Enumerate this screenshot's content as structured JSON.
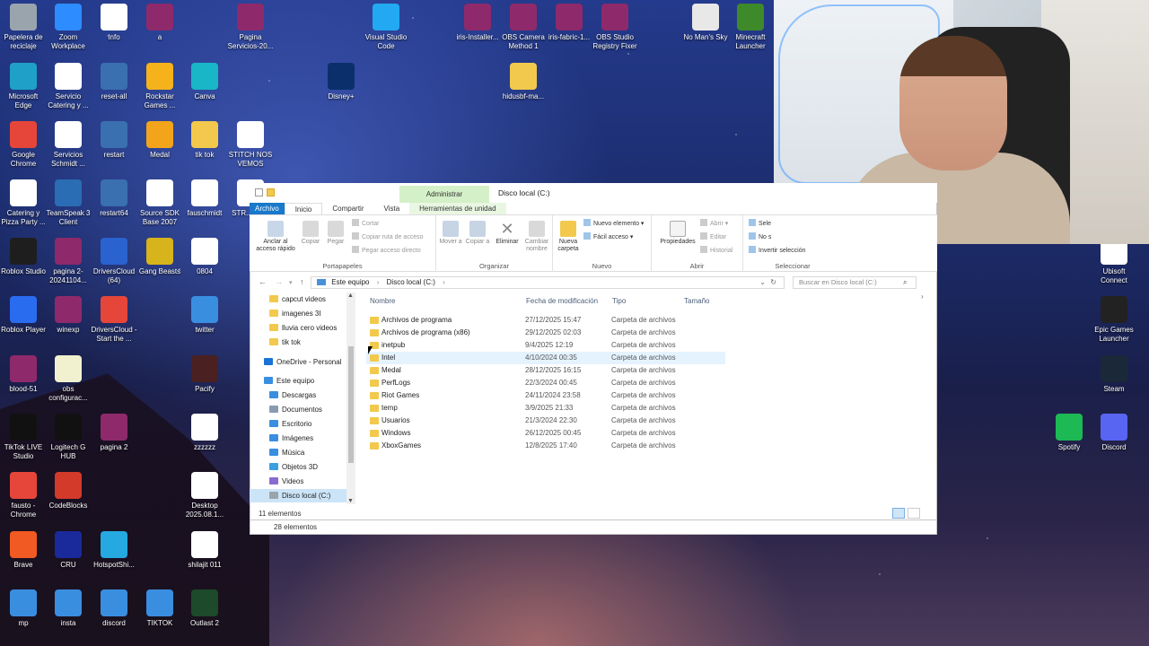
{
  "desktop": {
    "icons": [
      {
        "label": "Papelera de reciclaje",
        "icon": "recycle-bin-icon",
        "color": "#9aa4ad"
      },
      {
        "label": "Zoom Workplace",
        "icon": "zoom-icon",
        "color": "#2d8cff"
      },
      {
        "label": "Info",
        "icon": "text-file-icon",
        "color": "#ffffff"
      },
      {
        "label": "a",
        "icon": "winrar-icon",
        "color": "#8e2a6b"
      },
      {
        "label": "Pagina Servicios-20...",
        "icon": "winrar-icon",
        "color": "#8e2a6b"
      },
      {
        "label": "Visual Studio Code",
        "icon": "vscode-icon",
        "color": "#23a9f2"
      },
      {
        "label": "iris-Installer...",
        "icon": "winrar-icon",
        "color": "#8e2a6b"
      },
      {
        "label": "OBS Camera Method 1",
        "icon": "winrar-icon",
        "color": "#8e2a6b"
      },
      {
        "label": "iris-fabric-1...",
        "icon": "winrar-icon",
        "color": "#8e2a6b"
      },
      {
        "label": "OBS Studio Registry Fixer",
        "icon": "winrar-icon",
        "color": "#8e2a6b"
      },
      {
        "label": "No Man's Sky",
        "icon": "no-mans-sky-icon",
        "color": "#e8e8e8"
      },
      {
        "label": "Minecraft Launcher",
        "icon": "minecraft-icon",
        "color": "#3e8a2b"
      },
      {
        "label": "Microsoft Edge",
        "icon": "edge-icon",
        "color": "#1fa0c9"
      },
      {
        "label": "Servicio Catering y ...",
        "icon": "video-file-icon",
        "color": "#ffffff"
      },
      {
        "label": "reset-all",
        "icon": "batch-file-icon",
        "color": "#3a6fb0"
      },
      {
        "label": "Rockstar Games ...",
        "icon": "rockstar-icon",
        "color": "#f6b21b"
      },
      {
        "label": "Canva",
        "icon": "canva-icon",
        "color": "#19b6c8"
      },
      {
        "label": "Disney+",
        "icon": "disney-plus-icon",
        "color": "#0b2f6b"
      },
      {
        "label": "hidusbf-ma...",
        "icon": "folder-icon",
        "color": "#f2c94c"
      },
      {
        "label": "Google Chrome",
        "icon": "chrome-icon",
        "color": "#e6463a"
      },
      {
        "label": "Servicios Schmidt ...",
        "icon": "video-file-icon",
        "color": "#ffffff"
      },
      {
        "label": "restart",
        "icon": "batch-file-icon",
        "color": "#3a6fb0"
      },
      {
        "label": "Medal",
        "icon": "medal-icon",
        "color": "#f2a51b"
      },
      {
        "label": "tik tok",
        "icon": "folder-icon",
        "color": "#f2c94c"
      },
      {
        "label": "STITCH NOS VEMOS",
        "icon": "video-file-icon",
        "color": "#ffffff"
      },
      {
        "label": "Catering y Pizza Party ...",
        "icon": "video-file-icon",
        "color": "#ffffff"
      },
      {
        "label": "TeamSpeak 3 Client",
        "icon": "teamspeak-icon",
        "color": "#2a6db4"
      },
      {
        "label": "restart64",
        "icon": "batch-file-icon",
        "color": "#3a6fb0"
      },
      {
        "label": "Source SDK Base 2007",
        "icon": "file-icon",
        "color": "#ffffff"
      },
      {
        "label": "fauschmidt",
        "icon": "video-file-icon",
        "color": "#ffffff"
      },
      {
        "label": "STR... INI...",
        "icon": "video-file-icon",
        "color": "#ffffff"
      },
      {
        "label": "Roblox Studio",
        "icon": "roblox-studio-icon",
        "color": "#1e1e1e"
      },
      {
        "label": "pagina 2-20241104...",
        "icon": "winrar-icon",
        "color": "#8e2a6b"
      },
      {
        "label": "DriversCloud (64)",
        "icon": "driverscloud-icon",
        "color": "#2a62d0"
      },
      {
        "label": "Gang Beasts",
        "icon": "gang-beasts-icon",
        "color": "#d7b31c"
      },
      {
        "label": "0804",
        "icon": "video-file-icon",
        "color": "#ffffff"
      },
      {
        "label": "Roblox Player",
        "icon": "roblox-icon",
        "color": "#2a6cf0"
      },
      {
        "label": "winexp",
        "icon": "winrar-icon",
        "color": "#8e2a6b"
      },
      {
        "label": "DriversCloud - Start the ...",
        "icon": "chrome-icon",
        "color": "#e6463a"
      },
      {
        "label": "twitter",
        "icon": "image-file-icon",
        "color": "#3a8ee0"
      },
      {
        "label": "blood-51",
        "icon": "winrar-icon",
        "color": "#8e2a6b"
      },
      {
        "label": "obs configurac...",
        "icon": "json-file-icon",
        "color": "#f1f1d0"
      },
      {
        "label": "Pacify",
        "icon": "pacify-icon",
        "color": "#4a2020"
      },
      {
        "label": "TikTok LIVE Studio",
        "icon": "tiktok-icon",
        "color": "#111111"
      },
      {
        "label": "Logitech G HUB",
        "icon": "logitech-icon",
        "color": "#111111"
      },
      {
        "label": "pagina 2",
        "icon": "winrar-icon",
        "color": "#8e2a6b"
      },
      {
        "label": "zzzzzz",
        "icon": "video-file-icon",
        "color": "#ffffff"
      },
      {
        "label": "fausto - Chrome",
        "icon": "chrome-icon",
        "color": "#e6463a"
      },
      {
        "label": "CodeBlocks",
        "icon": "codeblocks-icon",
        "color": "#d33a2a"
      },
      {
        "label": "Desktop 2025.08.1...",
        "icon": "video-file-icon",
        "color": "#ffffff"
      },
      {
        "label": "Brave",
        "icon": "brave-icon",
        "color": "#f15a22"
      },
      {
        "label": "CRU",
        "icon": "cru-icon",
        "color": "#1a2a9a"
      },
      {
        "label": "HotspotShi...",
        "icon": "hotspot-shield-icon",
        "color": "#25a9e0"
      },
      {
        "label": "shilajit 011",
        "icon": "video-file-icon",
        "color": "#ffffff"
      },
      {
        "label": "mp",
        "icon": "image-file-icon",
        "color": "#3a8ee0"
      },
      {
        "label": "insta",
        "icon": "image-file-icon",
        "color": "#3a8ee0"
      },
      {
        "label": "discord",
        "icon": "image-file-icon",
        "color": "#3a8ee0"
      },
      {
        "label": "TIKTOK",
        "icon": "image-file-icon",
        "color": "#3a8ee0"
      },
      {
        "label": "Outlast 2",
        "icon": "outlast-icon",
        "color": "#1d4a2a"
      },
      {
        "label": "Ubisoft Connect",
        "icon": "ubisoft-icon",
        "color": "#ffffff"
      },
      {
        "label": "Epic Games Launcher",
        "icon": "epic-games-icon",
        "color": "#222222"
      },
      {
        "label": "Steam",
        "icon": "steam-icon",
        "color": "#1b2838"
      },
      {
        "label": "Spotify",
        "icon": "spotify-icon",
        "color": "#1db954"
      },
      {
        "label": "Discord",
        "icon": "discord-icon",
        "color": "#5865f2"
      }
    ]
  },
  "explorer": {
    "title": "Disco local (C:)",
    "context_tab": "Administrar",
    "tabs": [
      "Archivo",
      "Inicio",
      "Compartir",
      "Vista",
      "Herramientas de unidad"
    ],
    "ribbon": {
      "portapapeles": {
        "label": "Portapapeles",
        "pin": "Anclar al acceso rápido",
        "copy": "Copiar",
        "paste": "Pegar",
        "cut": "Cortar",
        "copy_path": "Copiar ruta de acceso",
        "paste_shortcut": "Pegar acceso directo"
      },
      "organizar": {
        "label": "Organizar",
        "move": "Mover a",
        "copy_to": "Copiar a",
        "delete": "Eliminar",
        "rename": "Cambiar nombre"
      },
      "nuevo": {
        "label": "Nuevo",
        "new_folder": "Nueva carpeta",
        "new_item": "Nuevo elemento",
        "easy_access": "Fácil acceso"
      },
      "abrir": {
        "label": "Abrir",
        "properties": "Propiedades",
        "open": "Abrir",
        "edit": "Editar",
        "history": "Historial"
      },
      "seleccionar": {
        "label": "Seleccionar",
        "select_all": "Sele",
        "select_none": "No s",
        "invert": "Invertir selección"
      }
    },
    "address": {
      "segments": [
        "Este equipo",
        "Disco local (C:)"
      ],
      "search_placeholder": "Buscar en Disco local (C:)"
    },
    "nav_pane": [
      {
        "label": "capcut videos",
        "icon": "folder-icon",
        "color": "#f2c94c",
        "selected": false
      },
      {
        "label": "imagenes 3I",
        "icon": "folder-icon",
        "color": "#f2c94c",
        "selected": false
      },
      {
        "label": "lluvia cero videos",
        "icon": "folder-icon",
        "color": "#f2c94c",
        "selected": false
      },
      {
        "label": "tik tok",
        "icon": "folder-icon",
        "color": "#f2c94c",
        "selected": false
      },
      {
        "label": "OneDrive - Personal",
        "icon": "onedrive-icon",
        "color": "#1a73d6",
        "selected": false
      },
      {
        "label": "Este equipo",
        "icon": "computer-icon",
        "color": "#3a8ee0",
        "selected": false
      },
      {
        "label": "Descargas",
        "icon": "downloads-icon",
        "color": "#3a8ee0",
        "selected": false
      },
      {
        "label": "Documentos",
        "icon": "documents-icon",
        "color": "#8a9bb0",
        "selected": false
      },
      {
        "label": "Escritorio",
        "icon": "desktop-icon",
        "color": "#3a8ee0",
        "selected": false
      },
      {
        "label": "Imágenes",
        "icon": "pictures-icon",
        "color": "#3a8ee0",
        "selected": false
      },
      {
        "label": "Música",
        "icon": "music-icon",
        "color": "#3a8ee0",
        "selected": false
      },
      {
        "label": "Objetos 3D",
        "icon": "3d-objects-icon",
        "color": "#3aa0e0",
        "selected": false
      },
      {
        "label": "Videos",
        "icon": "videos-icon",
        "color": "#8a6bd0",
        "selected": false
      },
      {
        "label": "Disco local (C:)",
        "icon": "drive-icon",
        "color": "#9aa4ad",
        "selected": true
      }
    ],
    "columns": {
      "name": "Nombre",
      "modified": "Fecha de modificación",
      "type": "Tipo",
      "size": "Tamaño"
    },
    "files": [
      {
        "name": "Archivos de programa",
        "modified": "27/12/2025 15:47",
        "type": "Carpeta de archivos"
      },
      {
        "name": "Archivos de programa (x86)",
        "modified": "29/12/2025 02:03",
        "type": "Carpeta de archivos"
      },
      {
        "name": "inetpub",
        "modified": "9/4/2025 12:19",
        "type": "Carpeta de archivos"
      },
      {
        "name": "Intel",
        "modified": "4/10/2024 00:35",
        "type": "Carpeta de archivos"
      },
      {
        "name": "Medal",
        "modified": "28/12/2025 16:15",
        "type": "Carpeta de archivos"
      },
      {
        "name": "PerfLogs",
        "modified": "22/3/2024 00:45",
        "type": "Carpeta de archivos"
      },
      {
        "name": "Riot Games",
        "modified": "24/11/2024 23:58",
        "type": "Carpeta de archivos"
      },
      {
        "name": "temp",
        "modified": "3/9/2025 21:33",
        "type": "Carpeta de archivos"
      },
      {
        "name": "Usuarios",
        "modified": "21/3/2024 22:30",
        "type": "Carpeta de archivos"
      },
      {
        "name": "Windows",
        "modified": "26/12/2025 00:45",
        "type": "Carpeta de archivos"
      },
      {
        "name": "XboxGames",
        "modified": "12/8/2025 17:40",
        "type": "Carpeta de archivos"
      }
    ],
    "status": "11 elementos",
    "status_behind": "28 elementos"
  }
}
